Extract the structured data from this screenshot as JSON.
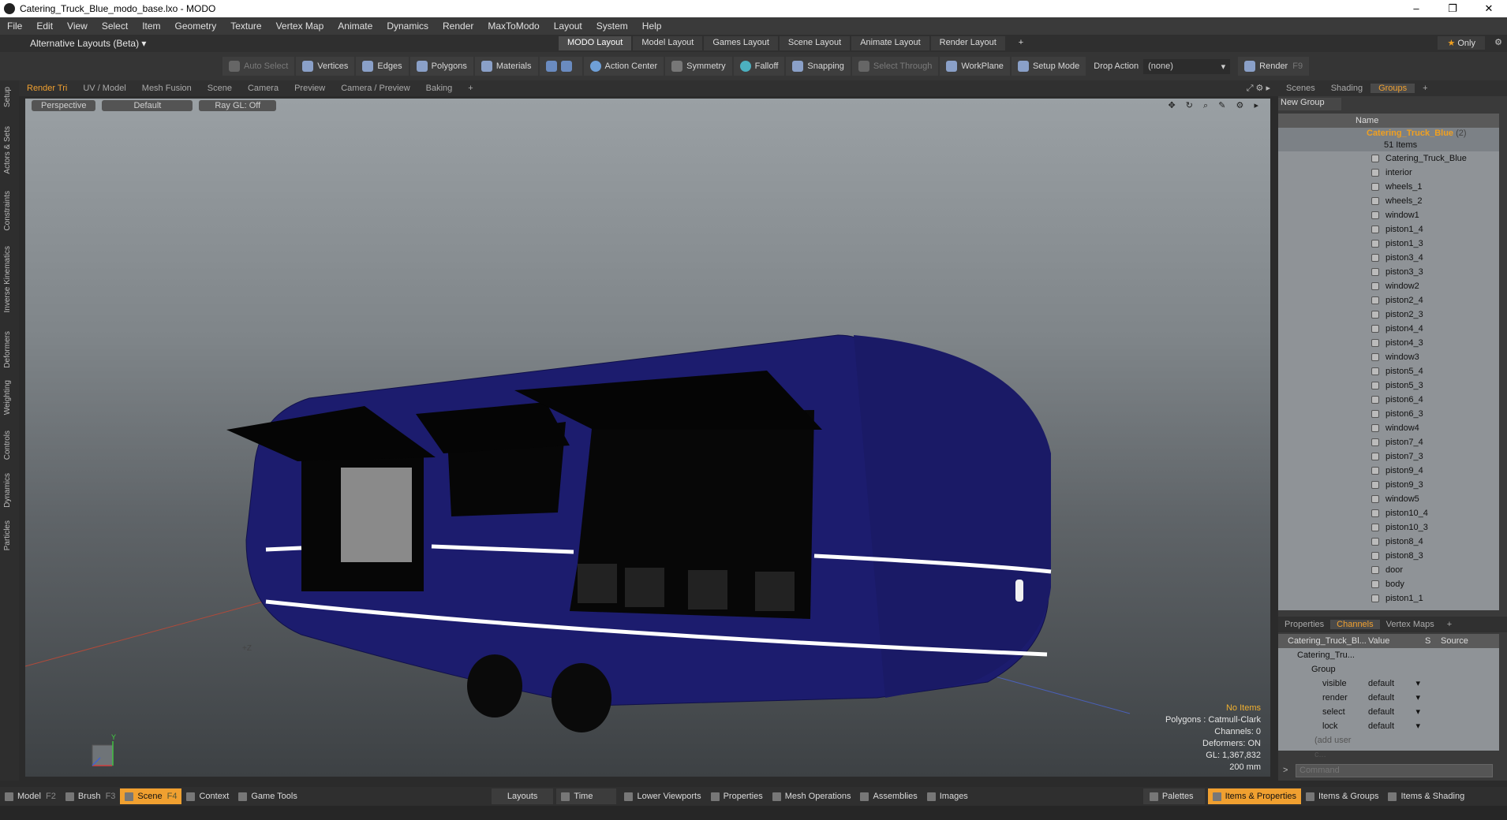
{
  "window": {
    "title": "Catering_Truck_Blue_modo_base.lxo - MODO",
    "min": "–",
    "max": "❐",
    "close": "✕"
  },
  "menu": [
    "File",
    "Edit",
    "View",
    "Select",
    "Item",
    "Geometry",
    "Texture",
    "Vertex Map",
    "Animate",
    "Dynamics",
    "Render",
    "MaxToModo",
    "Layout",
    "System",
    "Help"
  ],
  "layouts": {
    "alt": "Alternative Layouts (Beta) ▾",
    "tabs": [
      "MODO Layout",
      "Model Layout",
      "Games Layout",
      "Scene Layout",
      "Animate Layout",
      "Render Layout"
    ],
    "plus": "+",
    "only": "Only"
  },
  "toolbar": {
    "auto_select": "Auto Select",
    "vertices": "Vertices",
    "edges": "Edges",
    "polygons": "Polygons",
    "materials": "Materials",
    "action_center": "Action Center",
    "symmetry": "Symmetry",
    "falloff": "Falloff",
    "snapping": "Snapping",
    "select_through": "Select Through",
    "workplane": "WorkPlane",
    "setup_mode": "Setup Mode",
    "drop_action": "Drop Action",
    "drop_value": "(none)",
    "render": "Render",
    "render_key": "F9"
  },
  "left_tabs": [
    "Setup",
    "Actors & Sets",
    "Constraints",
    "Inverse Kinematics",
    "Deformers",
    "Weighting",
    "Controls",
    "Dynamics",
    "Particles"
  ],
  "viewport_tabs": [
    "Render Tri",
    "UV / Model",
    "Mesh Fusion",
    "Scene",
    "Camera",
    "Preview",
    "Camera / Preview",
    "Baking",
    "+"
  ],
  "viewport": {
    "perspective": "Perspective",
    "default": "Default",
    "raygl": "Ray GL: Off",
    "axis_y": "Y",
    "axis_z": "+Z",
    "info": {
      "no_items": "No Items",
      "polygons": "Polygons : Catmull-Clark",
      "channels": "Channels: 0",
      "deformers": "Deformers: ON",
      "gl": "GL: 1,367,832",
      "scale": "200 mm"
    }
  },
  "right_tabs": [
    "Scenes",
    "Shading",
    "Groups",
    "+"
  ],
  "groups": {
    "new_group": "New Group",
    "name_header": "Name",
    "root_name": "Catering_Truck_Blue",
    "root_count": "(2)",
    "root_sub": "51 Items",
    "items": [
      "Catering_Truck_Blue",
      "interior",
      "wheels_1",
      "wheels_2",
      "window1",
      "piston1_4",
      "piston1_3",
      "piston3_4",
      "piston3_3",
      "window2",
      "piston2_4",
      "piston2_3",
      "piston4_4",
      "piston4_3",
      "window3",
      "piston5_4",
      "piston5_3",
      "piston6_4",
      "piston6_3",
      "window4",
      "piston7_4",
      "piston7_3",
      "piston9_4",
      "piston9_3",
      "window5",
      "piston10_4",
      "piston10_3",
      "piston8_4",
      "piston8_3",
      "door",
      "body",
      "piston1_1"
    ]
  },
  "channel_tabs": [
    "Properties",
    "Channels",
    "Vertex Maps",
    "+"
  ],
  "channels": {
    "col_name": "Catering_Truck_Bl...",
    "col_value": "Value",
    "col_s": "S",
    "col_source": "Source",
    "root": "Catering_Tru...",
    "group": "Group",
    "rows": [
      {
        "name": "visible",
        "value": "default"
      },
      {
        "name": "render",
        "value": "default"
      },
      {
        "name": "select",
        "value": "default"
      },
      {
        "name": "lock",
        "value": "default"
      }
    ],
    "add_user": "(add user c..."
  },
  "command": {
    "prompt": ">",
    "placeholder": "Command"
  },
  "bottom": {
    "model": "Model",
    "model_key": "F2",
    "brush": "Brush",
    "brush_key": "F3",
    "scene": "Scene",
    "scene_key": "F4",
    "context": "Context",
    "game_tools": "Game Tools",
    "layouts": "Layouts",
    "time": "Time",
    "lower_viewports": "Lower Viewports",
    "properties": "Properties",
    "mesh_operations": "Mesh Operations",
    "assemblies": "Assemblies",
    "images": "Images",
    "palettes": "Palettes",
    "items_properties": "Items & Properties",
    "items_groups": "Items & Groups",
    "items_shading": "Items & Shading"
  },
  "colors": {
    "accent": "#f0a030",
    "truck_body": "#1c1c6e",
    "selected_item": "#f0a020"
  }
}
